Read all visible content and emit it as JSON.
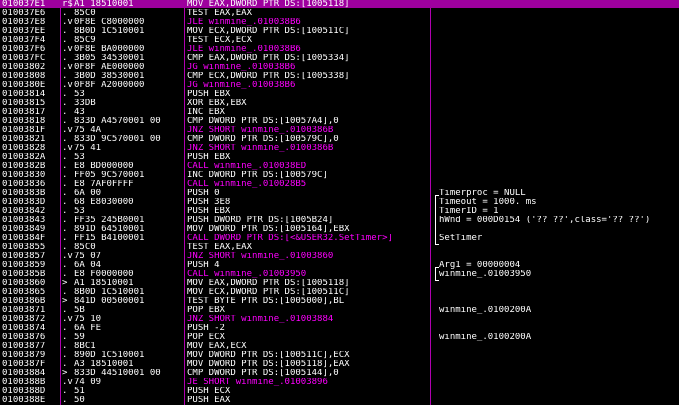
{
  "rows": [
    {
      "addr": "010037E1",
      "marker": "r$",
      "hex": "A1 18510001",
      "asm": "MOV EAX,DWORD PTR DS:[1005118]",
      "kind": "normal",
      "selected": true
    },
    {
      "addr": "010037E6",
      "marker": ".",
      "hex": "85C0",
      "asm": "TEST EAX,EAX",
      "kind": "normal"
    },
    {
      "addr": "010037E8",
      "marker": ".v",
      "hex": "0F8E C8000000",
      "asm": "JLE winmine_.010038B6",
      "kind": "jmp"
    },
    {
      "addr": "010037EE",
      "marker": ".",
      "hex": "8B0D 1C510001",
      "asm": "MOV ECX,DWORD PTR DS:[100511C]",
      "kind": "normal"
    },
    {
      "addr": "010037F4",
      "marker": ".",
      "hex": "85C9",
      "asm": "TEST ECX,ECX",
      "kind": "normal"
    },
    {
      "addr": "010037F6",
      "marker": ".v",
      "hex": "0F8E BA000000",
      "asm": "JLE winmine_.010038B6",
      "kind": "jmp"
    },
    {
      "addr": "010037FC",
      "marker": ".",
      "hex": "3B05 34530001",
      "asm": "CMP EAX,DWORD PTR DS:[1005334]",
      "kind": "normal"
    },
    {
      "addr": "01003802",
      "marker": ".v",
      "hex": "0F8F AE000000",
      "asm": "JG winmine_.010038B6",
      "kind": "jmp"
    },
    {
      "addr": "01003808",
      "marker": ".",
      "hex": "3B0D 38530001",
      "asm": "CMP ECX,DWORD PTR DS:[1005338]",
      "kind": "normal"
    },
    {
      "addr": "0100380E",
      "marker": ".v",
      "hex": "0F8F A2000000",
      "asm": "JG winmine_.010038B6",
      "kind": "jmp"
    },
    {
      "addr": "01003814",
      "marker": ".",
      "hex": "53",
      "asm": "PUSH EBX",
      "kind": "normal"
    },
    {
      "addr": "01003815",
      "marker": ".",
      "hex": "33DB",
      "asm": "XOR EBX,EBX",
      "kind": "normal"
    },
    {
      "addr": "01003817",
      "marker": ".",
      "hex": "43",
      "asm": "INC EBX",
      "kind": "normal"
    },
    {
      "addr": "01003818",
      "marker": ".",
      "hex": "833D A4570001 00",
      "asm": "CMP DWORD PTR DS:[10057A4],0",
      "kind": "normal"
    },
    {
      "addr": "0100381F",
      "marker": ".v",
      "hex": "75 4A",
      "asm": "JNZ SHORT winmine_.0100386B",
      "kind": "jmp"
    },
    {
      "addr": "01003821",
      "marker": ".",
      "hex": "833D 9C570001 00",
      "asm": "CMP DWORD PTR DS:[100579C],0",
      "kind": "normal"
    },
    {
      "addr": "01003828",
      "marker": ".v",
      "hex": "75 41",
      "asm": "JNZ SHORT winmine_.0100386B",
      "kind": "jmp"
    },
    {
      "addr": "0100382A",
      "marker": ".",
      "hex": "53",
      "asm": "PUSH EBX",
      "kind": "normal"
    },
    {
      "addr": "0100382B",
      "marker": ".",
      "hex": "E8 BD000000",
      "asm": "CALL winmine_.010038ED",
      "kind": "call"
    },
    {
      "addr": "01003830",
      "marker": ".",
      "hex": "FF05 9C570001",
      "asm": "INC DWORD PTR DS:[100579C]",
      "kind": "normal"
    },
    {
      "addr": "01003836",
      "marker": ".",
      "hex": "E8 7AF0FFFF",
      "asm": "CALL winmine_.010028B5",
      "kind": "call"
    },
    {
      "addr": "0100383B",
      "marker": ".",
      "hex": "6A 00",
      "asm": "PUSH 0",
      "kind": "normal",
      "comment": "Timerproc = NULL"
    },
    {
      "addr": "0100383D",
      "marker": ".",
      "hex": "68 E8030000",
      "asm": "PUSH 3E8",
      "kind": "normal",
      "comment": "Timeout = 1000. ms"
    },
    {
      "addr": "01003842",
      "marker": ".",
      "hex": "53",
      "asm": "PUSH EBX",
      "kind": "normal",
      "comment": "TimerID = 1"
    },
    {
      "addr": "01003843",
      "marker": ".",
      "hex": "FF35 245B0001",
      "asm": "PUSH DWORD PTR DS:[1005B24]",
      "kind": "normal",
      "comment": "hWnd = 000D0154 ('?? ??',class='?? ??')"
    },
    {
      "addr": "01003849",
      "marker": ".",
      "hex": "891D 64510001",
      "asm": "MOV DWORD PTR DS:[1005164],EBX",
      "kind": "normal"
    },
    {
      "addr": "0100384F",
      "marker": ".",
      "hex": "FF15 B4100001",
      "asm": "CALL DWORD PTR DS:[<&USER32.SetTimer>]",
      "kind": "call",
      "comment": "SetTimer"
    },
    {
      "addr": "01003855",
      "marker": ".",
      "hex": "85C0",
      "asm": "TEST EAX,EAX",
      "kind": "normal"
    },
    {
      "addr": "01003857",
      "marker": ".v",
      "hex": "75 07",
      "asm": "JNZ SHORT winmine_.01003860",
      "kind": "jmp"
    },
    {
      "addr": "01003859",
      "marker": ".",
      "hex": "6A 04",
      "asm": "PUSH 4",
      "kind": "normal",
      "comment": "Arg1 = 00000004"
    },
    {
      "addr": "0100385B",
      "marker": ".",
      "hex": "E8 F0000000",
      "asm": "CALL winmine_.01003950",
      "kind": "call",
      "comment": "winmine_.01003950"
    },
    {
      "addr": "01003860",
      "marker": ">",
      "hex": "A1 18510001",
      "asm": "MOV EAX,DWORD PTR DS:[1005118]",
      "kind": "normal"
    },
    {
      "addr": "01003865",
      "marker": ".",
      "hex": "8B0D 1C510001",
      "asm": "MOV ECX,DWORD PTR DS:[100511C]",
      "kind": "normal"
    },
    {
      "addr": "0100386B",
      "marker": ">",
      "hex": "841D 00500001",
      "asm": "TEST BYTE PTR DS:[1005000],BL",
      "kind": "normal"
    },
    {
      "addr": "01003871",
      "marker": ".",
      "hex": "5B",
      "asm": "POP EBX",
      "kind": "normal",
      "comment": "winmine_.0100200A"
    },
    {
      "addr": "01003872",
      "marker": ".v",
      "hex": "75 10",
      "asm": "JNZ SHORT winmine_.01003884",
      "kind": "jmp"
    },
    {
      "addr": "01003874",
      "marker": ".",
      "hex": "6A FE",
      "asm": "PUSH -2",
      "kind": "normal"
    },
    {
      "addr": "01003876",
      "marker": ".",
      "hex": "59",
      "asm": "POP ECX",
      "kind": "normal",
      "comment": "winmine_.0100200A"
    },
    {
      "addr": "01003877",
      "marker": ".",
      "hex": "8BC1",
      "asm": "MOV EAX,ECX",
      "kind": "normal"
    },
    {
      "addr": "01003879",
      "marker": ".",
      "hex": "890D 1C510001",
      "asm": "MOV DWORD PTR DS:[100511C],ECX",
      "kind": "normal"
    },
    {
      "addr": "0100387F",
      "marker": ".",
      "hex": "A3 18510001",
      "asm": "MOV DWORD PTR DS:[1005118],EAX",
      "kind": "normal"
    },
    {
      "addr": "01003884",
      "marker": ">",
      "hex": "833D 44510001 00",
      "asm": "CMP DWORD PTR DS:[1005144],0",
      "kind": "normal"
    },
    {
      "addr": "0100388B",
      "marker": ".v",
      "hex": "74 09",
      "asm": "JE SHORT winmine_.01003896",
      "kind": "jmp"
    },
    {
      "addr": "0100388D",
      "marker": ".",
      "hex": "51",
      "asm": "PUSH ECX",
      "kind": "normal"
    },
    {
      "addr": "0100388E",
      "marker": ".",
      "hex": "50",
      "asm": "PUSH EAX",
      "kind": "normal"
    }
  ]
}
